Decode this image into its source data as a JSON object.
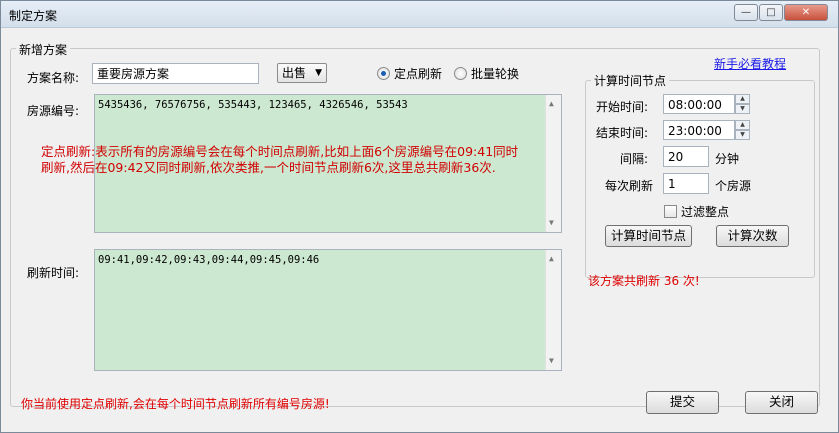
{
  "window": {
    "title": "制定方案"
  },
  "form": {
    "group_title": "新增方案",
    "name_label": "方案名称:",
    "name_value": "重要房源方案",
    "type_select": "出售",
    "radio_fixed": "定点刷新",
    "radio_rotate": "批量轮换",
    "help_link": "新手必看教程",
    "house_label": "房源编号:",
    "house_ids": "5435436, 76576756, 535443, 123465, 4326546, 53543",
    "explanation_line1": "定点刷新:表示所有的房源编号会在每个时间点刷新,比如上面6个房源编号在09:41同时",
    "explanation_line2": "刷新,然后在09:42又同时刷新,依次类推,一个时间节点刷新6次,这里总共刷新36次.",
    "refresh_label": "刷新时间:",
    "refresh_times": "09:41,09:42,09:43,09:44,09:45,09:46"
  },
  "calc": {
    "title": "计算时间节点",
    "start_label": "开始时间:",
    "start_value": "08:00:00",
    "end_label": "结束时间:",
    "end_value": "23:00:00",
    "interval_label": "间隔:",
    "interval_value": "20",
    "interval_unit": "分钟",
    "per_label": "每次刷新",
    "per_value": "1",
    "per_unit": "个房源",
    "filter_label": "过滤整点",
    "calc_nodes_button": "计算时间节点",
    "calc_count_button": "计算次数",
    "result_text": "该方案共刷新 36 次!"
  },
  "footer": {
    "status_text": "你当前使用定点刷新,会在每个时间节点刷新所有编号房源!",
    "submit_button": "提交",
    "close_button": "关闭"
  },
  "colors": {
    "memo_bg": "#cde8d0",
    "warning_red": "#e00000",
    "link_blue": "#1a1ae6"
  }
}
